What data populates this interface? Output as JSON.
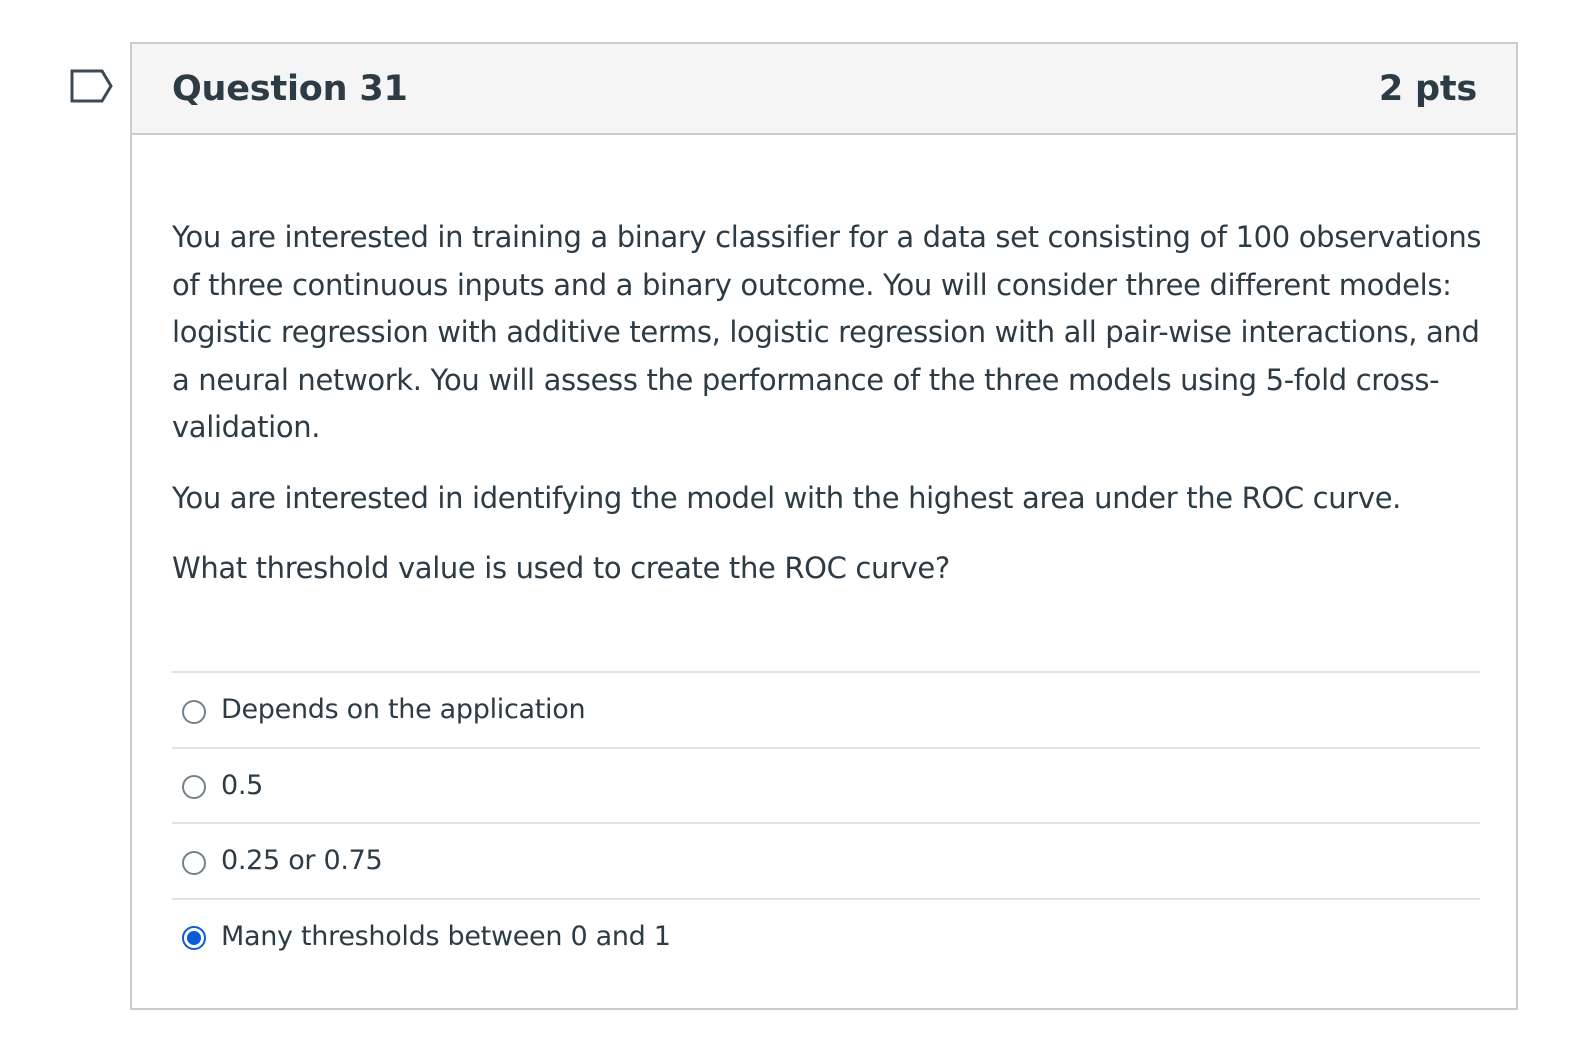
{
  "question": {
    "title": "Question 31",
    "points": "2 pts",
    "paragraphs": [
      "You are interested in training a binary classifier for a data set consisting of 100 observations of three continuous inputs and a binary outcome. You will consider three different models: logistic regression with additive terms, logistic regression with all pair-wise interactions, and a neural network. You will assess the performance of the three models using 5-fold cross-validation.",
      "You are interested in identifying the model with the highest area under the ROC curve.",
      "What threshold value is used to create the ROC curve?"
    ],
    "answers": [
      {
        "label": "Depends on the application",
        "selected": false
      },
      {
        "label": "0.5",
        "selected": false
      },
      {
        "label": "0.25 or 0.75",
        "selected": false
      },
      {
        "label": "Many thresholds between 0 and 1",
        "selected": true
      }
    ]
  },
  "icons": {
    "flag": "flag-question-icon",
    "radio_unselected": "radio-unselected-icon",
    "radio_selected": "radio-selected-icon"
  },
  "colors": {
    "text": "#2d3b45",
    "border": "#c7cdd1",
    "header_bg": "#f5f5f5",
    "selected_radio": "#0b5bd7"
  }
}
